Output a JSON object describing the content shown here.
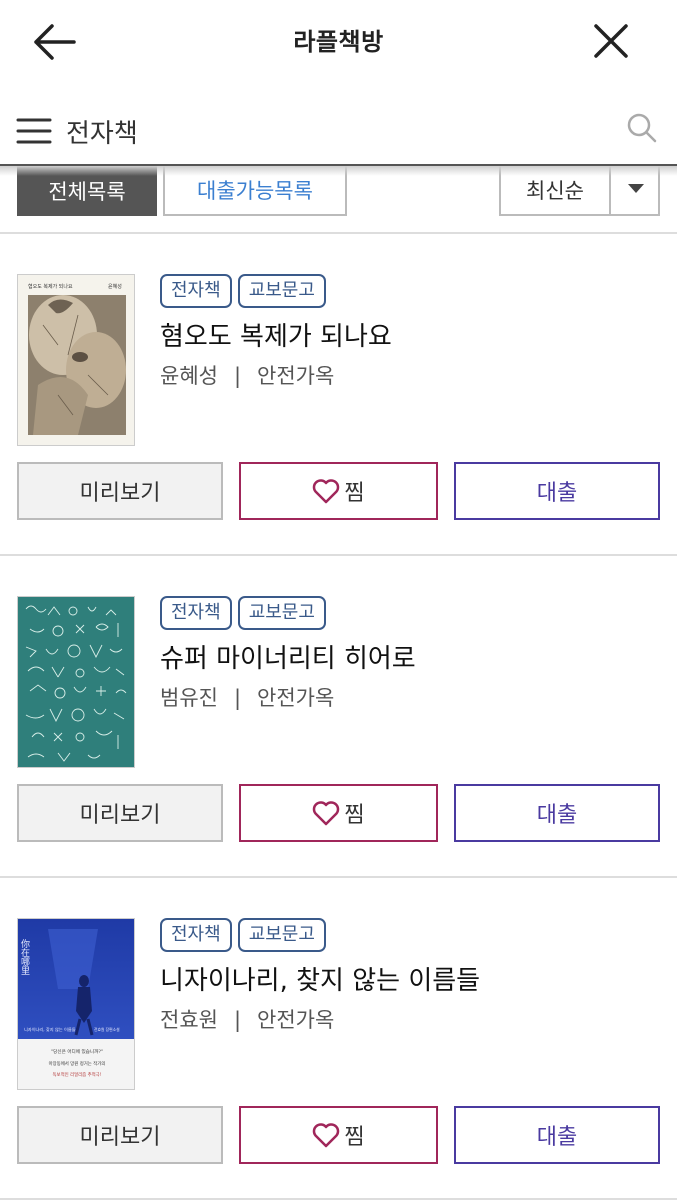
{
  "header": {
    "title": "라플책방",
    "back_icon": "arrow-left-icon",
    "close_icon": "close-icon"
  },
  "search": {
    "value": "전자책",
    "menu_icon": "hamburger-menu-icon",
    "search_icon": "search-icon"
  },
  "filters": {
    "tab_all": "전체목록",
    "tab_available": "대출가능목록",
    "sort_selected": "최신순"
  },
  "books": [
    {
      "badges": [
        "전자책",
        "교보문고"
      ],
      "title": "혐오도 복제가 되나요",
      "author": "윤혜성",
      "publisher": "안전가옥",
      "cover_title": "혐오도 복제가 되나요",
      "cover_author": "윤혜성"
    },
    {
      "badges": [
        "전자책",
        "교보문고"
      ],
      "title": "슈퍼 마이너리티 히어로",
      "author": "범유진",
      "publisher": "안전가옥"
    },
    {
      "badges": [
        "전자책",
        "교보문고"
      ],
      "title": "니자이나리, 찾지 않는 이름들",
      "author": "전효원",
      "publisher": "안전가옥",
      "cover_vertical": "你在哪里",
      "cover_subtitle": "니자이나리, 찾지 않는 이름들",
      "cover_author": "전효원 장편소설",
      "cover_quote": "\"당신은 어디에 있습니까?\"",
      "cover_blurb_1": "아장동에서 망원 정거는 작가의",
      "cover_blurb_2": "독보적인 리얼리즘 추적극!"
    }
  ],
  "buttons": {
    "preview": "미리보기",
    "wish": "찜",
    "loan": "대출"
  },
  "colors": {
    "badge": "#3a5a8a",
    "wish_border": "#a0265a",
    "loan_border": "#4a3aa0",
    "tab_available_text": "#3b7fd0",
    "tab_all_bg": "#555555"
  }
}
